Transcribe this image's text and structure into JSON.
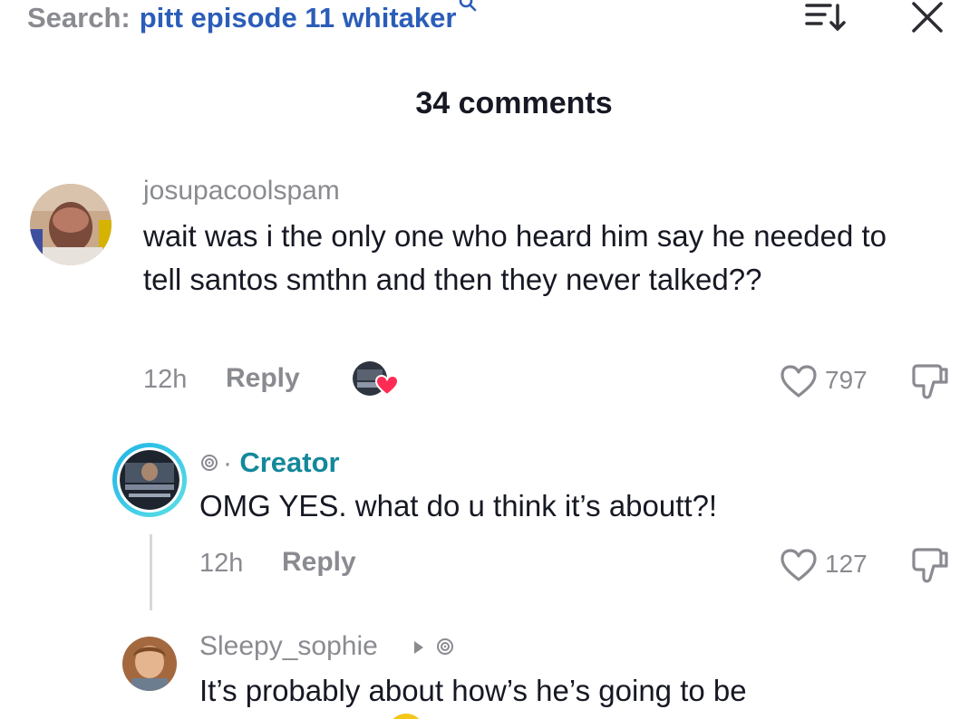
{
  "search": {
    "label": "Search:",
    "query": "pitt episode 11 whitaker",
    "query_suffix_icon": "search-icon"
  },
  "header": {
    "comments_title": "34 comments",
    "sort_icon": "sort-icon",
    "close_icon": "close-icon"
  },
  "comments": [
    {
      "username": "josupacoolspam",
      "text": "wait was i the only one who heard him say he needed to tell santos smthn and then they never talked??",
      "time": "12h",
      "reply_label": "Reply",
      "likes": "797",
      "creator_liked": true
    },
    {
      "badge": "Creator",
      "text": "OMG YES. what do u think it’s aboutt?!",
      "time": "12h",
      "reply_label": "Reply",
      "likes": "127"
    },
    {
      "username": "Sleepy_sophie",
      "text": "It’s probably about how’s he’s going to be"
    }
  ],
  "colors": {
    "search_query": "#2b5db9",
    "creator": "#14889a",
    "muted": "#8a8b91",
    "heart_badge": "#fe2c55",
    "ring_outer": "#1fb3e6",
    "ring_inner": "#5de1e6"
  }
}
